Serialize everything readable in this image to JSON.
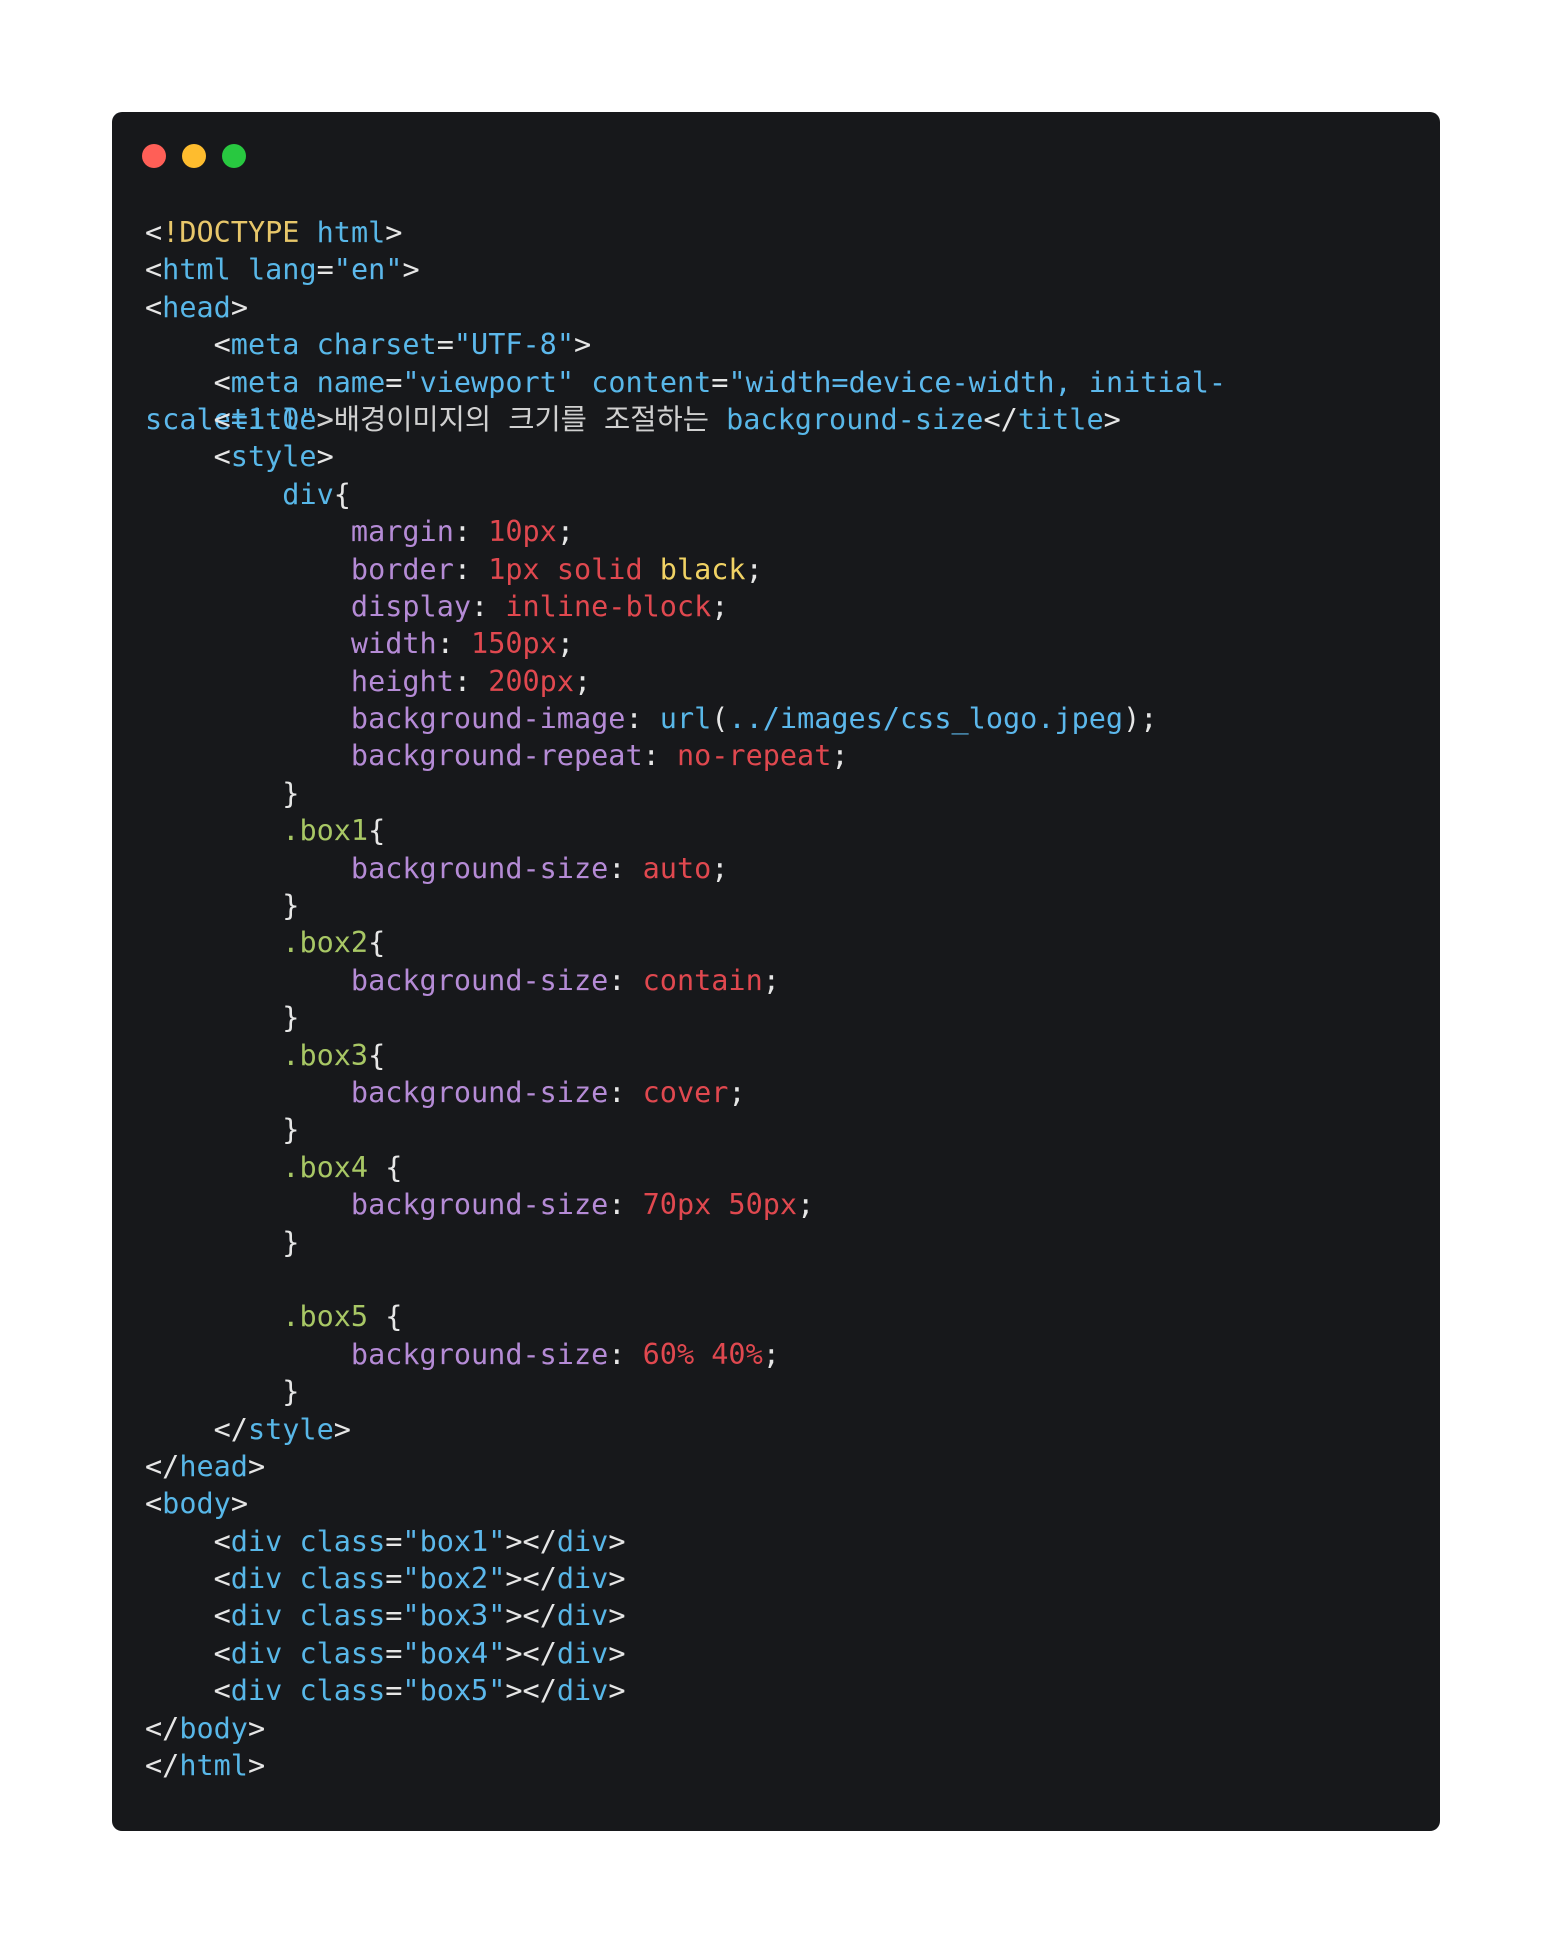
{
  "window": {
    "traffic_lights": [
      {
        "name": "close",
        "color": "#ff5f57"
      },
      {
        "name": "minimize",
        "color": "#febc2e"
      },
      {
        "name": "maximize",
        "color": "#28c840"
      }
    ]
  },
  "code": {
    "lines": [
      [
        {
          "t": "<",
          "c": "default"
        },
        {
          "t": "!DOCTYPE",
          "c": "doctype"
        },
        {
          "t": " ",
          "c": "default"
        },
        {
          "t": "html",
          "c": "tag"
        },
        {
          "t": ">",
          "c": "default"
        }
      ],
      [
        {
          "t": "<",
          "c": "default"
        },
        {
          "t": "html",
          "c": "tag"
        },
        {
          "t": " ",
          "c": "default"
        },
        {
          "t": "lang",
          "c": "attr"
        },
        {
          "t": "=",
          "c": "default"
        },
        {
          "t": "\"en\"",
          "c": "string"
        },
        {
          "t": ">",
          "c": "default"
        }
      ],
      [
        {
          "t": "<",
          "c": "default"
        },
        {
          "t": "head",
          "c": "tag"
        },
        {
          "t": ">",
          "c": "default"
        }
      ],
      [
        {
          "t": "    <",
          "c": "default"
        },
        {
          "t": "meta",
          "c": "tag"
        },
        {
          "t": " ",
          "c": "default"
        },
        {
          "t": "charset",
          "c": "attr"
        },
        {
          "t": "=",
          "c": "default"
        },
        {
          "t": "\"UTF-8\"",
          "c": "string"
        },
        {
          "t": ">",
          "c": "default"
        }
      ],
      [
        {
          "t": "    <",
          "c": "default"
        },
        {
          "t": "meta",
          "c": "tag"
        },
        {
          "t": " ",
          "c": "default"
        },
        {
          "t": "name",
          "c": "attr"
        },
        {
          "t": "=",
          "c": "default"
        },
        {
          "t": "\"viewport\"",
          "c": "string"
        },
        {
          "t": " ",
          "c": "default"
        },
        {
          "t": "content",
          "c": "attr"
        },
        {
          "t": "=",
          "c": "default"
        },
        {
          "t": "\"width=device-width, initial-",
          "c": "string"
        }
      ],
      {
        "overlay": [
          [
            {
              "t": "scale=1.0\"",
              "c": "string"
            },
            {
              "t": ">",
              "c": "default"
            }
          ],
          [
            {
              "t": "    <",
              "c": "default"
            },
            {
              "t": "title",
              "c": "tag"
            },
            {
              "t": ">배경이미지의 크기를 조절하는 ",
              "c": "text"
            },
            {
              "t": "background-size",
              "c": "tag"
            },
            {
              "t": "</",
              "c": "default"
            },
            {
              "t": "title",
              "c": "tag"
            },
            {
              "t": ">",
              "c": "default"
            }
          ]
        ]
      },
      [
        {
          "t": "    <",
          "c": "default"
        },
        {
          "t": "style",
          "c": "tag"
        },
        {
          "t": ">",
          "c": "default"
        }
      ],
      [
        {
          "t": "        ",
          "c": "default"
        },
        {
          "t": "div",
          "c": "tag"
        },
        {
          "t": "{",
          "c": "default"
        }
      ],
      [
        {
          "t": "            ",
          "c": "default"
        },
        {
          "t": "margin",
          "c": "prop"
        },
        {
          "t": ": ",
          "c": "default"
        },
        {
          "t": "10px",
          "c": "value"
        },
        {
          "t": ";",
          "c": "default"
        }
      ],
      [
        {
          "t": "            ",
          "c": "default"
        },
        {
          "t": "border",
          "c": "prop"
        },
        {
          "t": ": ",
          "c": "default"
        },
        {
          "t": "1px solid",
          "c": "value"
        },
        {
          "t": " ",
          "c": "default"
        },
        {
          "t": "black",
          "c": "keyword"
        },
        {
          "t": ";",
          "c": "default"
        }
      ],
      [
        {
          "t": "            ",
          "c": "default"
        },
        {
          "t": "display",
          "c": "prop"
        },
        {
          "t": ": ",
          "c": "default"
        },
        {
          "t": "inline-block",
          "c": "value"
        },
        {
          "t": ";",
          "c": "default"
        }
      ],
      [
        {
          "t": "            ",
          "c": "default"
        },
        {
          "t": "width",
          "c": "prop"
        },
        {
          "t": ": ",
          "c": "default"
        },
        {
          "t": "150px",
          "c": "value"
        },
        {
          "t": ";",
          "c": "default"
        }
      ],
      [
        {
          "t": "            ",
          "c": "default"
        },
        {
          "t": "height",
          "c": "prop"
        },
        {
          "t": ": ",
          "c": "default"
        },
        {
          "t": "200px",
          "c": "value"
        },
        {
          "t": ";",
          "c": "default"
        }
      ],
      [
        {
          "t": "            ",
          "c": "default"
        },
        {
          "t": "background-image",
          "c": "prop"
        },
        {
          "t": ": ",
          "c": "default"
        },
        {
          "t": "url",
          "c": "func"
        },
        {
          "t": "(",
          "c": "default"
        },
        {
          "t": "../images/css_logo.jpeg",
          "c": "string"
        },
        {
          "t": ");",
          "c": "default"
        }
      ],
      [
        {
          "t": "            ",
          "c": "default"
        },
        {
          "t": "background-repeat",
          "c": "prop"
        },
        {
          "t": ": ",
          "c": "default"
        },
        {
          "t": "no-repeat",
          "c": "value"
        },
        {
          "t": ";",
          "c": "default"
        }
      ],
      [
        {
          "t": "        }",
          "c": "default"
        }
      ],
      [
        {
          "t": "        ",
          "c": "default"
        },
        {
          "t": ".box1",
          "c": "selector"
        },
        {
          "t": "{",
          "c": "default"
        }
      ],
      [
        {
          "t": "            ",
          "c": "default"
        },
        {
          "t": "background-size",
          "c": "prop"
        },
        {
          "t": ": ",
          "c": "default"
        },
        {
          "t": "auto",
          "c": "value"
        },
        {
          "t": ";",
          "c": "default"
        }
      ],
      [
        {
          "t": "        }",
          "c": "default"
        }
      ],
      [
        {
          "t": "        ",
          "c": "default"
        },
        {
          "t": ".box2",
          "c": "selector"
        },
        {
          "t": "{",
          "c": "default"
        }
      ],
      [
        {
          "t": "            ",
          "c": "default"
        },
        {
          "t": "background-size",
          "c": "prop"
        },
        {
          "t": ": ",
          "c": "default"
        },
        {
          "t": "contain",
          "c": "value"
        },
        {
          "t": ";",
          "c": "default"
        }
      ],
      [
        {
          "t": "        }",
          "c": "default"
        }
      ],
      [
        {
          "t": "        ",
          "c": "default"
        },
        {
          "t": ".box3",
          "c": "selector"
        },
        {
          "t": "{",
          "c": "default"
        }
      ],
      [
        {
          "t": "            ",
          "c": "default"
        },
        {
          "t": "background-size",
          "c": "prop"
        },
        {
          "t": ": ",
          "c": "default"
        },
        {
          "t": "cover",
          "c": "value"
        },
        {
          "t": ";",
          "c": "default"
        }
      ],
      [
        {
          "t": "        }",
          "c": "default"
        }
      ],
      [
        {
          "t": "        ",
          "c": "default"
        },
        {
          "t": ".box4",
          "c": "selector"
        },
        {
          "t": " {",
          "c": "default"
        }
      ],
      [
        {
          "t": "            ",
          "c": "default"
        },
        {
          "t": "background-size",
          "c": "prop"
        },
        {
          "t": ": ",
          "c": "default"
        },
        {
          "t": "70px 50px",
          "c": "value"
        },
        {
          "t": ";",
          "c": "default"
        }
      ],
      [
        {
          "t": "        }",
          "c": "default"
        }
      ],
      [],
      [
        {
          "t": "        ",
          "c": "default"
        },
        {
          "t": ".box5",
          "c": "selector"
        },
        {
          "t": " {",
          "c": "default"
        }
      ],
      [
        {
          "t": "            ",
          "c": "default"
        },
        {
          "t": "background-size",
          "c": "prop"
        },
        {
          "t": ": ",
          "c": "default"
        },
        {
          "t": "60% 40%",
          "c": "value"
        },
        {
          "t": ";",
          "c": "default"
        }
      ],
      [
        {
          "t": "        }",
          "c": "default"
        }
      ],
      [
        {
          "t": "    </",
          "c": "default"
        },
        {
          "t": "style",
          "c": "tag"
        },
        {
          "t": ">",
          "c": "default"
        }
      ],
      [
        {
          "t": "</",
          "c": "default"
        },
        {
          "t": "head",
          "c": "tag"
        },
        {
          "t": ">",
          "c": "default"
        }
      ],
      [
        {
          "t": "<",
          "c": "default"
        },
        {
          "t": "body",
          "c": "tag"
        },
        {
          "t": ">",
          "c": "default"
        }
      ],
      [
        {
          "t": "    <",
          "c": "default"
        },
        {
          "t": "div",
          "c": "tag"
        },
        {
          "t": " ",
          "c": "default"
        },
        {
          "t": "class",
          "c": "attr"
        },
        {
          "t": "=",
          "c": "default"
        },
        {
          "t": "\"box1\"",
          "c": "string"
        },
        {
          "t": "></",
          "c": "default"
        },
        {
          "t": "div",
          "c": "tag"
        },
        {
          "t": ">",
          "c": "default"
        }
      ],
      [
        {
          "t": "    <",
          "c": "default"
        },
        {
          "t": "div",
          "c": "tag"
        },
        {
          "t": " ",
          "c": "default"
        },
        {
          "t": "class",
          "c": "attr"
        },
        {
          "t": "=",
          "c": "default"
        },
        {
          "t": "\"box2\"",
          "c": "string"
        },
        {
          "t": "></",
          "c": "default"
        },
        {
          "t": "div",
          "c": "tag"
        },
        {
          "t": ">",
          "c": "default"
        }
      ],
      [
        {
          "t": "    <",
          "c": "default"
        },
        {
          "t": "div",
          "c": "tag"
        },
        {
          "t": " ",
          "c": "default"
        },
        {
          "t": "class",
          "c": "attr"
        },
        {
          "t": "=",
          "c": "default"
        },
        {
          "t": "\"box3\"",
          "c": "string"
        },
        {
          "t": "></",
          "c": "default"
        },
        {
          "t": "div",
          "c": "tag"
        },
        {
          "t": ">",
          "c": "default"
        }
      ],
      [
        {
          "t": "    <",
          "c": "default"
        },
        {
          "t": "div",
          "c": "tag"
        },
        {
          "t": " ",
          "c": "default"
        },
        {
          "t": "class",
          "c": "attr"
        },
        {
          "t": "=",
          "c": "default"
        },
        {
          "t": "\"box4\"",
          "c": "string"
        },
        {
          "t": "></",
          "c": "default"
        },
        {
          "t": "div",
          "c": "tag"
        },
        {
          "t": ">",
          "c": "default"
        }
      ],
      [
        {
          "t": "    <",
          "c": "default"
        },
        {
          "t": "div",
          "c": "tag"
        },
        {
          "t": " ",
          "c": "default"
        },
        {
          "t": "class",
          "c": "attr"
        },
        {
          "t": "=",
          "c": "default"
        },
        {
          "t": "\"box5\"",
          "c": "string"
        },
        {
          "t": "></",
          "c": "default"
        },
        {
          "t": "div",
          "c": "tag"
        },
        {
          "t": ">",
          "c": "default"
        }
      ],
      [
        {
          "t": "</",
          "c": "default"
        },
        {
          "t": "body",
          "c": "tag"
        },
        {
          "t": ">",
          "c": "default"
        }
      ],
      [
        {
          "t": "</",
          "c": "default"
        },
        {
          "t": "html",
          "c": "tag"
        },
        {
          "t": ">",
          "c": "default"
        }
      ]
    ]
  }
}
